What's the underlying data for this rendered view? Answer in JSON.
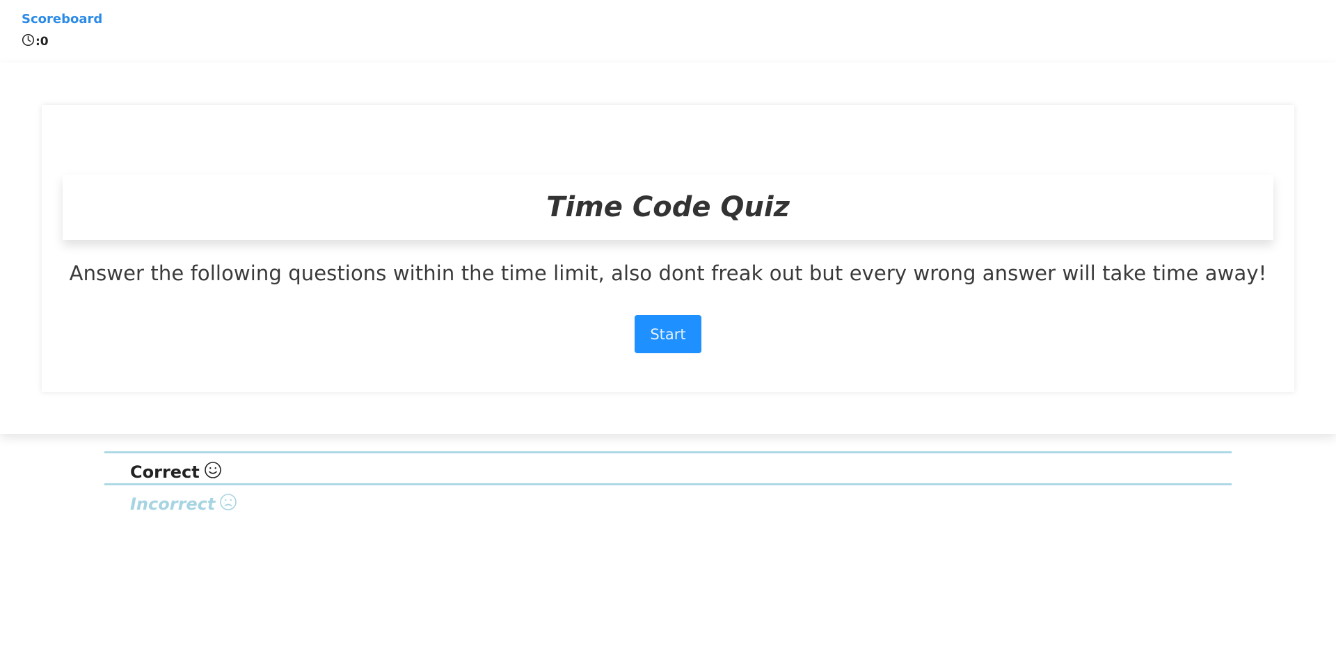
{
  "header": {
    "scoreboard_label": "Scoreboard",
    "timer_value": ":0",
    "timer_icon": "clock-icon"
  },
  "quiz": {
    "title": "Time Code Quiz",
    "instructions": "Answer the following questions within the time limit, also dont freak out but every wrong answer will take time away!",
    "start_label": "Start"
  },
  "feedback": {
    "correct_label": "Correct",
    "correct_icon": "smile-icon",
    "incorrect_label": "Incorrect",
    "incorrect_icon": "frown-icon"
  },
  "colors": {
    "accent": "#1e90ff",
    "link": "#2a8ae6",
    "divider": "#add8e6",
    "incorrect_text": "#a6d4e2"
  }
}
